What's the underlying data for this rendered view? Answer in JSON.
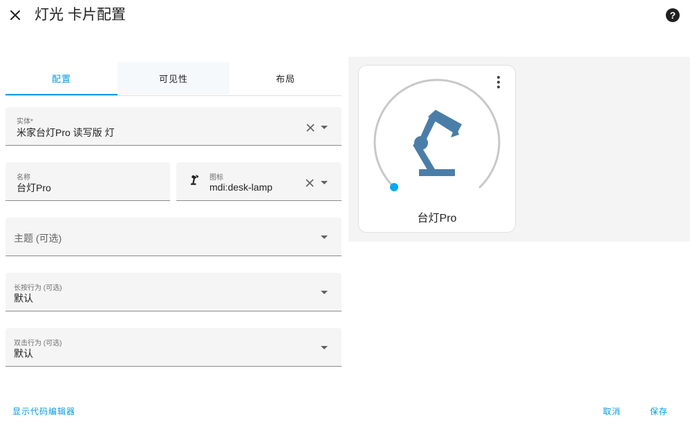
{
  "header": {
    "title": "灯光 卡片配置",
    "close_icon": "close-icon",
    "help_icon": "help-circle-icon"
  },
  "tabs": [
    {
      "label": "配置",
      "active": true
    },
    {
      "label": "可见性",
      "active": false
    },
    {
      "label": "布局",
      "active": false
    }
  ],
  "form": {
    "entity": {
      "label": "实体*",
      "value": "米家台灯Pro 读写版  灯"
    },
    "name": {
      "label": "名称",
      "value": "台灯Pro"
    },
    "icon": {
      "label": "图标",
      "value": "mdi:desk-lamp",
      "icon": "desk-lamp-icon"
    },
    "theme": {
      "placeholder": "主题 (可选)"
    },
    "hold_action": {
      "label": "长按行为 (可选)",
      "value": "默认"
    },
    "double_tap_action": {
      "label": "双击行为 (可选)",
      "value": "默认"
    }
  },
  "preview": {
    "name": "台灯Pro",
    "icon": "desk-lamp-icon",
    "brightness_fraction": 0.0,
    "accent_color": "#4a7ea8"
  },
  "footer": {
    "show_code_editor": "显示代码编辑器",
    "cancel": "取消",
    "save": "保存"
  },
  "colors": {
    "primary": "#039be5",
    "slider_dot": "#03a9f4"
  }
}
